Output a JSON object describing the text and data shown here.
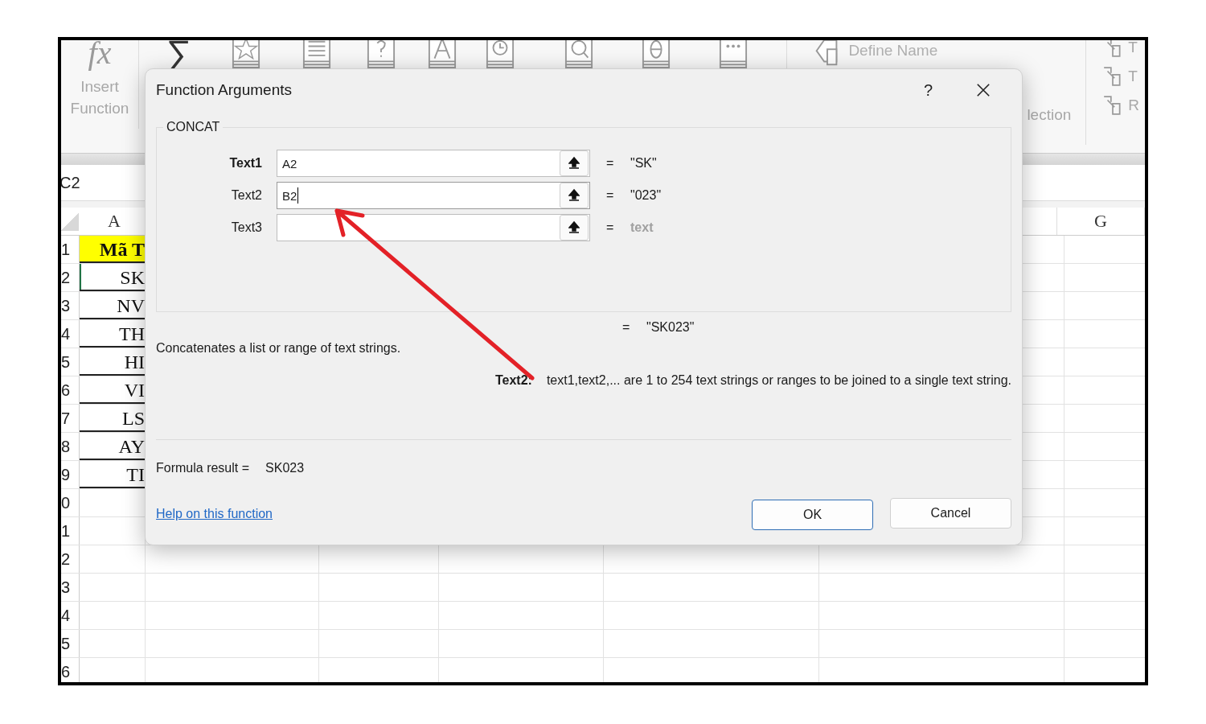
{
  "ribbon": {
    "insert_function": {
      "symbol": "fx",
      "label": "Insert Function"
    },
    "autosum_symbol": "∑",
    "define_name": "Define Name",
    "selection_fragment": "lection",
    "right_fragments": [
      "T",
      "T",
      "R"
    ]
  },
  "name_box": "C2",
  "column_headers": [
    "A",
    "G"
  ],
  "rows": [
    {
      "number": "1",
      "cell": "Mã T",
      "header": true
    },
    {
      "number": "2",
      "cell": "SK",
      "header": false
    },
    {
      "number": "3",
      "cell": "NV",
      "header": false
    },
    {
      "number": "4",
      "cell": "TH",
      "header": false
    },
    {
      "number": "5",
      "cell": "HI",
      "header": false
    },
    {
      "number": "6",
      "cell": "VI",
      "header": false
    },
    {
      "number": "7",
      "cell": "LS",
      "header": false
    },
    {
      "number": "8",
      "cell": "AY",
      "header": false
    },
    {
      "number": "9",
      "cell": "TI",
      "header": false
    },
    {
      "number": "0",
      "cell": "",
      "header": false
    },
    {
      "number": "1",
      "cell": "",
      "header": false
    },
    {
      "number": "2",
      "cell": "",
      "header": false
    },
    {
      "number": "3",
      "cell": "",
      "header": false
    },
    {
      "number": "4",
      "cell": "",
      "header": false
    },
    {
      "number": "5",
      "cell": "",
      "header": false
    },
    {
      "number": "6",
      "cell": "",
      "header": false
    }
  ],
  "dialog": {
    "title": "Function Arguments",
    "help": "?",
    "function_name": "CONCAT",
    "arguments": [
      {
        "label": "Text1",
        "value": "A2",
        "equals": "=",
        "result": "\"SK\"",
        "required": true,
        "focused": false,
        "result_dimmed": false
      },
      {
        "label": "Text2",
        "value": "B2",
        "equals": "=",
        "result": "\"023\"",
        "required": false,
        "focused": true,
        "result_dimmed": false
      },
      {
        "label": "Text3",
        "equals": "=",
        "result": "text",
        "required": false,
        "focused": false,
        "result_dimmed": true
      }
    ],
    "total_equals": "=",
    "total_result": "\"SK023\"",
    "description": "Concatenates a list or range of text strings.",
    "argument_help_label": "Text2:",
    "argument_help_text": "text1,text2,... are 1 to 254 text strings or ranges to be joined to a single text string.",
    "formula_result_label": "Formula result =",
    "formula_result": "SK023",
    "help_link": "Help on this function",
    "buttons": [
      {
        "label": "OK",
        "default": true
      },
      {
        "label": "Cancel",
        "default": false
      }
    ]
  }
}
